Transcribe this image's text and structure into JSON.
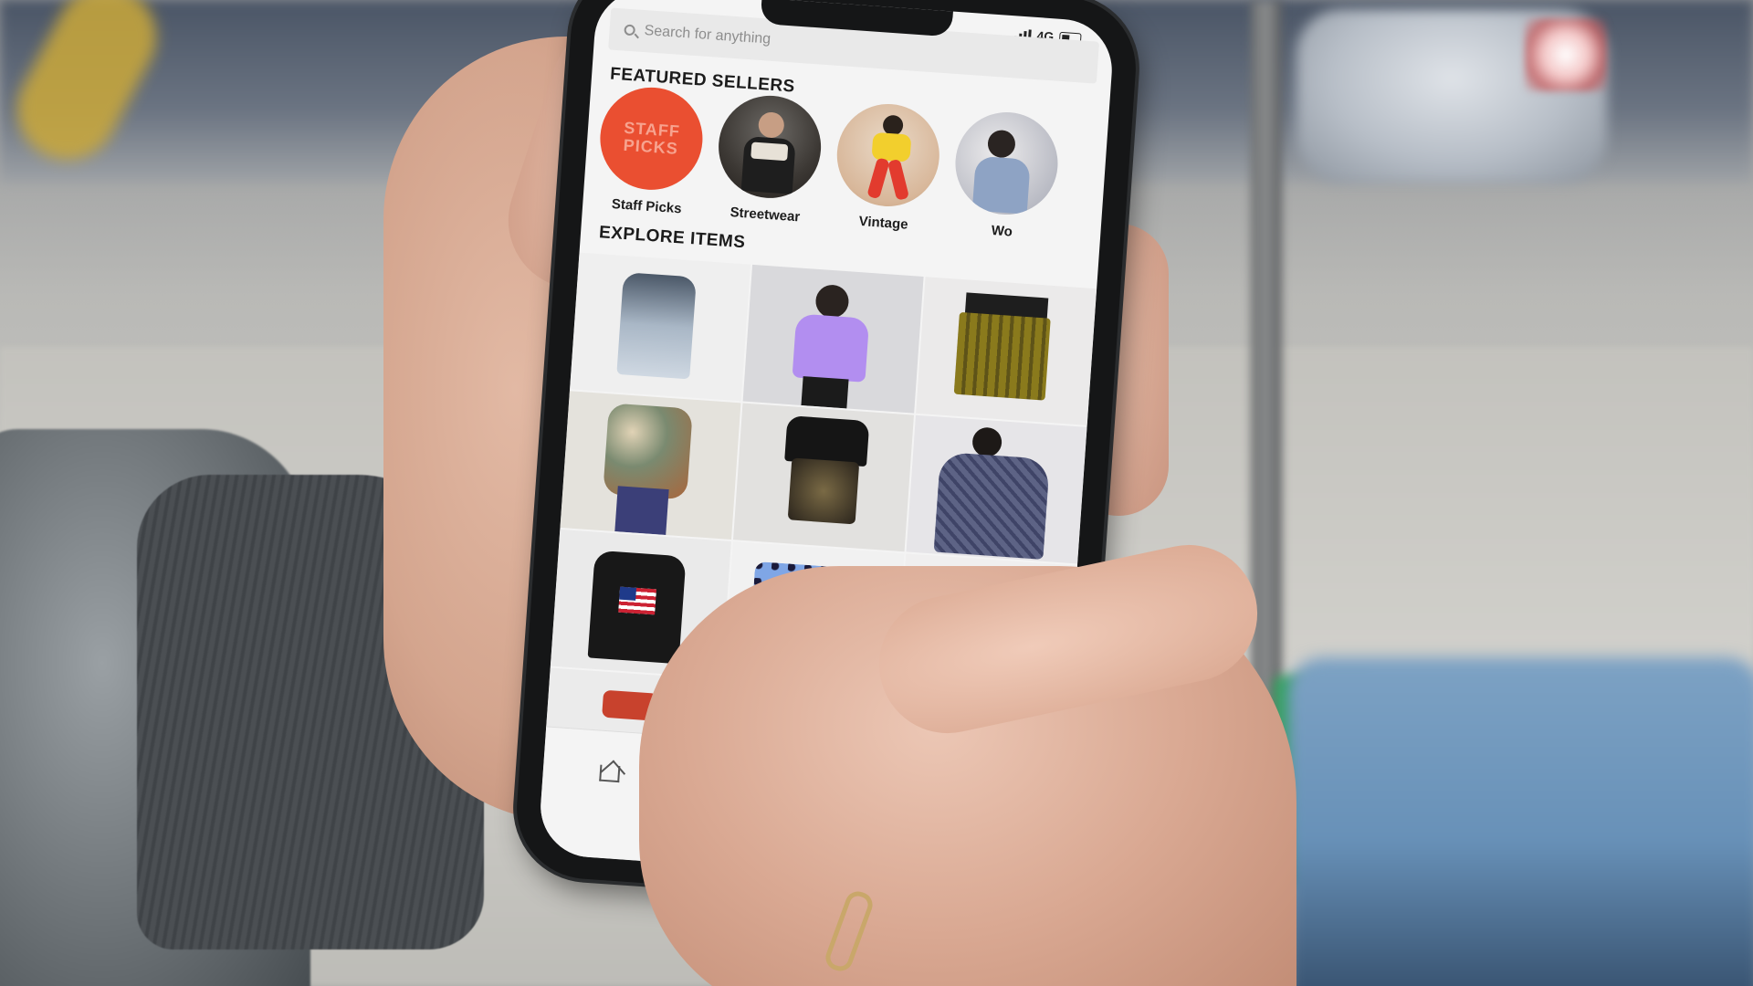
{
  "app": {
    "search_placeholder": "Search for anything",
    "status": {
      "network": "4G"
    },
    "featured_title": "FEATURED SELLERS",
    "explore_title": "EXPLORE ITEMS",
    "sellers": [
      {
        "label": "Staff Picks",
        "badge_text": "STAFF PICKS"
      },
      {
        "label": "Streetwear"
      },
      {
        "label": "Vintage"
      },
      {
        "label": "Wo"
      }
    ],
    "tabs": [
      {
        "icon": "home-icon"
      },
      {
        "icon": "search-icon",
        "active": true
      },
      {
        "icon": "camera-icon"
      },
      {
        "icon": "mail-icon"
      },
      {
        "icon": "profile-icon",
        "notification": true
      }
    ]
  },
  "colors": {
    "staff_picks": "#ea4f31",
    "notification_dot": "#e04040"
  }
}
